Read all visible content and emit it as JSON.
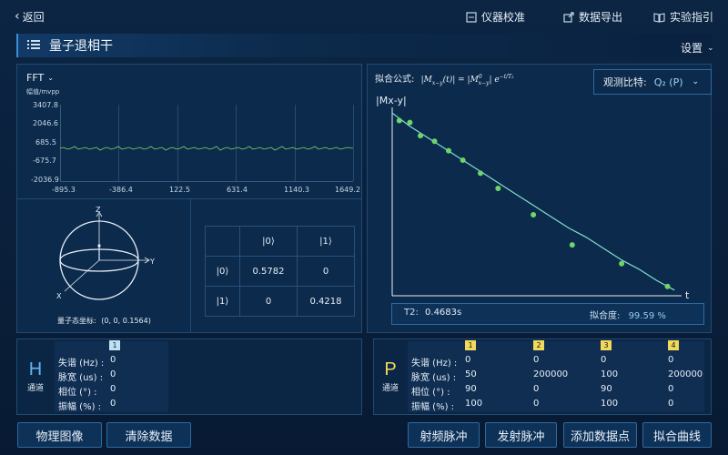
{
  "topbar": {
    "back_label": "返回",
    "calibrate_label": "仪器校准",
    "export_label": "数据导出",
    "guide_label": "实验指引"
  },
  "title_bar": {
    "title": "量子退相干",
    "settings_label": "设置"
  },
  "fft": {
    "mode_label": "FFT",
    "y_unit": "幅值/mvpp",
    "y_ticks": [
      "3407.8",
      "2046.6",
      "685.5",
      "-675.7",
      "-2036.9"
    ],
    "x_ticks": [
      "-895.3",
      "-386.4",
      "122.5",
      "631.4",
      "1140.3",
      "1649.2"
    ]
  },
  "bloch": {
    "axis_z": "Z",
    "axis_y": "Y",
    "axis_x": "X",
    "coord_label": "量子态坐标:",
    "coord_value": "(0, 0, 0.1564)"
  },
  "density_matrix": {
    "col_headers": [
      "|0⟩",
      "|1⟩"
    ],
    "row_headers": [
      "|0⟩",
      "|1⟩"
    ],
    "values": [
      [
        "0.5782",
        "0"
      ],
      [
        "0",
        "0.4218"
      ]
    ]
  },
  "fit": {
    "formula_label": "拟合公式:",
    "formula_lhs": "|M",
    "formula_lhs_sub": "x−y",
    "formula_lhs_tail": "(t)| = |M",
    "formula_rhs_sup": "0",
    "formula_rhs_sub": "x−y",
    "formula_rhs_tail": "| e",
    "observe_label": "观测比特:",
    "observe_value": "Q₂ (P)",
    "y_axis_label": "|Mx-y|",
    "x_axis_label": "t",
    "t2_label": "T2:",
    "t2_value": "0.4683s",
    "goodness_label": "拟合度:",
    "goodness_value": "99.59 %"
  },
  "chart_data": {
    "type": "scatter",
    "title": "",
    "xlabel": "t",
    "ylabel": "|Mx-y|",
    "series": [
      {
        "name": "",
        "type": "scatter",
        "x": [
          0.02,
          0.05,
          0.08,
          0.12,
          0.16,
          0.2,
          0.25,
          0.3,
          0.4,
          0.51,
          0.65,
          0.78
        ],
        "y": [
          0.93,
          0.92,
          0.85,
          0.82,
          0.77,
          0.72,
          0.65,
          0.57,
          0.43,
          0.27,
          0.17,
          0.05
        ]
      },
      {
        "name": "",
        "type": "line",
        "x": [
          0.0,
          0.05,
          0.1,
          0.15,
          0.2,
          0.25,
          0.3,
          0.35,
          0.4,
          0.45,
          0.5,
          0.55,
          0.6,
          0.65,
          0.7,
          0.75,
          0.8
        ],
        "y": [
          0.97,
          0.9,
          0.84,
          0.78,
          0.72,
          0.66,
          0.6,
          0.54,
          0.48,
          0.42,
          0.36,
          0.31,
          0.25,
          0.19,
          0.14,
          0.08,
          0.03
        ]
      }
    ],
    "xlim": [
      0,
      0.82
    ],
    "ylim": [
      0,
      1
    ],
    "grid": false
  },
  "h_channel": {
    "name": "H",
    "sub": "通道",
    "col_index": "1",
    "rows": [
      {
        "label": "失谐 (Hz) :",
        "values": [
          "0"
        ]
      },
      {
        "label": "脉宽 (us) :",
        "values": [
          "0"
        ]
      },
      {
        "label": "相位 (°) :",
        "values": [
          "0"
        ]
      },
      {
        "label": "振幅 (%) :",
        "values": [
          "0"
        ]
      }
    ]
  },
  "p_channel": {
    "name": "P",
    "sub": "通道",
    "col_indexes": [
      "1",
      "2",
      "3",
      "4"
    ],
    "rows": [
      {
        "label": "失谐 (Hz) :",
        "values": [
          "0",
          "0",
          "0",
          "0"
        ]
      },
      {
        "label": "脉宽 (us) :",
        "values": [
          "50",
          "200000",
          "100",
          "200000"
        ]
      },
      {
        "label": "相位 (°) :",
        "values": [
          "90",
          "0",
          "90",
          "0"
        ]
      },
      {
        "label": "振幅 (%) :",
        "values": [
          "100",
          "0",
          "100",
          "0"
        ]
      }
    ]
  },
  "bottom_buttons": {
    "physical_image": "物理图像",
    "clear_data": "清除数据",
    "rf_pulse": "射频脉冲",
    "emit_pulse": "发射脉冲",
    "add_point": "添加数据点",
    "fit_curve": "拟合曲线"
  }
}
